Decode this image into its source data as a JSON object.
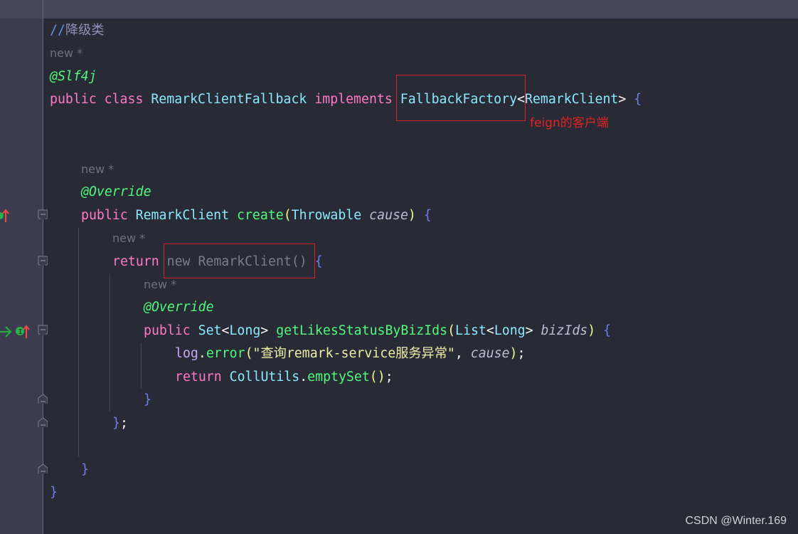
{
  "editor": {
    "lines": [
      {
        "indent": 0,
        "tokens": [
          {
            "t": "//",
            "c": "cm"
          },
          {
            "t": "降级类",
            "c": "cmt"
          }
        ]
      },
      {
        "indent": 0,
        "hint": "new *"
      },
      {
        "indent": 0,
        "tokens": [
          {
            "t": "@Slf4j",
            "c": "ann"
          }
        ]
      },
      {
        "indent": 0,
        "tokens": [
          {
            "t": "public class ",
            "c": "kw"
          },
          {
            "t": "RemarkClientFallback ",
            "c": "cls"
          },
          {
            "t": "implements ",
            "c": "kw"
          },
          {
            "t": "FallbackFactory",
            "c": "cls"
          },
          {
            "t": "<",
            "c": "plain"
          },
          {
            "t": "RemarkClient",
            "c": "cls"
          },
          {
            "t": "> ",
            "c": "plain"
          },
          {
            "t": "{",
            "c": "brace"
          }
        ]
      },
      {
        "indent": 0,
        "tokens": []
      },
      {
        "indent": 0,
        "tokens": []
      },
      {
        "indent": 1,
        "hint": "new *"
      },
      {
        "indent": 1,
        "tokens": [
          {
            "t": "@Override",
            "c": "ann"
          }
        ]
      },
      {
        "indent": 1,
        "tokens": [
          {
            "t": "public ",
            "c": "kw"
          },
          {
            "t": "RemarkClient ",
            "c": "cls"
          },
          {
            "t": "create",
            "c": "fn"
          },
          {
            "t": "(",
            "c": "paren"
          },
          {
            "t": "Throwable ",
            "c": "cls"
          },
          {
            "t": "cause",
            "c": "param"
          },
          {
            "t": ")",
            "c": "paren"
          },
          {
            "t": " {",
            "c": "brace"
          }
        ]
      },
      {
        "indent": 2,
        "hint": "new *"
      },
      {
        "indent": 2,
        "tokens": [
          {
            "t": "return ",
            "c": "kw"
          },
          {
            "t": "new RemarkClient() ",
            "c": "dim"
          },
          {
            "t": "{",
            "c": "brace"
          }
        ]
      },
      {
        "indent": 3,
        "hint": "new *"
      },
      {
        "indent": 3,
        "tokens": [
          {
            "t": "@Override",
            "c": "ann"
          }
        ]
      },
      {
        "indent": 3,
        "tokens": [
          {
            "t": "public ",
            "c": "kw"
          },
          {
            "t": "Set",
            "c": "cls"
          },
          {
            "t": "<",
            "c": "plain"
          },
          {
            "t": "Long",
            "c": "cls"
          },
          {
            "t": "> ",
            "c": "plain"
          },
          {
            "t": "getLikesStatusByBizIds",
            "c": "fn"
          },
          {
            "t": "(",
            "c": "paren"
          },
          {
            "t": "List",
            "c": "cls"
          },
          {
            "t": "<",
            "c": "plain"
          },
          {
            "t": "Long",
            "c": "cls"
          },
          {
            "t": "> ",
            "c": "plain"
          },
          {
            "t": "bizIds",
            "c": "param"
          },
          {
            "t": ")",
            "c": "paren"
          },
          {
            "t": " {",
            "c": "brace"
          }
        ]
      },
      {
        "indent": 4,
        "tokens": [
          {
            "t": "log",
            "c": "field"
          },
          {
            "t": ".",
            "c": "plain"
          },
          {
            "t": "error",
            "c": "fn"
          },
          {
            "t": "(",
            "c": "paren"
          },
          {
            "t": "\"查询remark-service服务异常\"",
            "c": "str"
          },
          {
            "t": ", ",
            "c": "plain"
          },
          {
            "t": "cause",
            "c": "param"
          },
          {
            "t": ")",
            "c": "paren"
          },
          {
            "t": ";",
            "c": "plain"
          }
        ]
      },
      {
        "indent": 4,
        "tokens": [
          {
            "t": "return ",
            "c": "kw"
          },
          {
            "t": "CollUtils",
            "c": "cls"
          },
          {
            "t": ".",
            "c": "plain"
          },
          {
            "t": "emptySet",
            "c": "fn"
          },
          {
            "t": "()",
            "c": "paren"
          },
          {
            "t": ";",
            "c": "plain"
          }
        ]
      },
      {
        "indent": 3,
        "tokens": [
          {
            "t": "}",
            "c": "brace"
          }
        ]
      },
      {
        "indent": 2,
        "tokens": [
          {
            "t": "}",
            "c": "brace"
          },
          {
            "t": ";",
            "c": "plain"
          }
        ]
      },
      {
        "indent": 0,
        "tokens": []
      },
      {
        "indent": 1,
        "tokens": [
          {
            "t": "}",
            "c": "brace"
          }
        ]
      },
      {
        "indent": 0,
        "tokens": [
          {
            "t": "}",
            "c": "brace"
          }
        ]
      }
    ]
  },
  "annotation": {
    "label": "feign的客户端",
    "color": "#e32222"
  },
  "gutter": {
    "implements_icon_glyph": "I"
  },
  "watermark": "CSDN @Winter.169"
}
